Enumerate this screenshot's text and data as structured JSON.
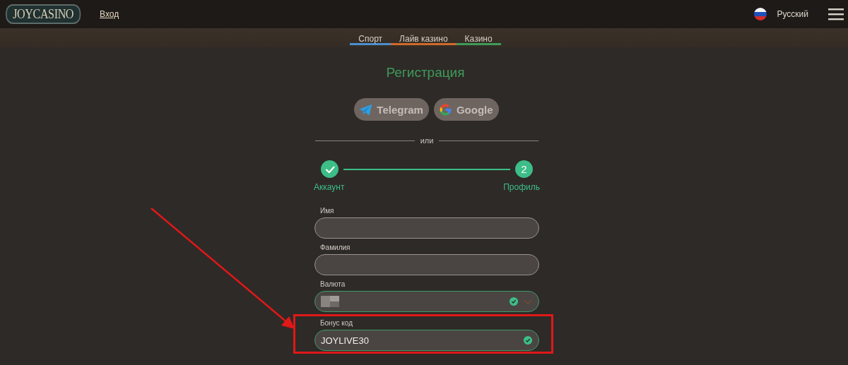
{
  "header": {
    "logo": "JOYCASINO",
    "login_link": "Вход",
    "language": "Русский"
  },
  "tabs": [
    {
      "label": "Спорт",
      "color": "#4a8fd0"
    },
    {
      "label": "Лайв казино",
      "color": "#d06a2c"
    },
    {
      "label": "Казино",
      "color": "#3f9a5a"
    }
  ],
  "title": "Регистрация",
  "social_buttons": [
    {
      "kind": "telegram",
      "label": "Telegram"
    },
    {
      "kind": "google",
      "label": "Google"
    }
  ],
  "divider_text": "или",
  "steps": [
    {
      "label": "Аккаунт",
      "done": true
    },
    {
      "label": "Профиль",
      "done": false,
      "number": "2"
    }
  ],
  "fields": [
    {
      "kind": "text",
      "label": "Имя",
      "valid": false,
      "highlighted": false
    },
    {
      "kind": "text",
      "label": "Фамилия",
      "valid": false,
      "highlighted": false
    },
    {
      "kind": "select",
      "label": "Валюта",
      "valid": true,
      "highlighted": false
    },
    {
      "kind": "text",
      "label": "Бонус код",
      "value": "JOYLIVE30",
      "valid": true,
      "highlighted": true
    }
  ],
  "annotation_arrow": true
}
